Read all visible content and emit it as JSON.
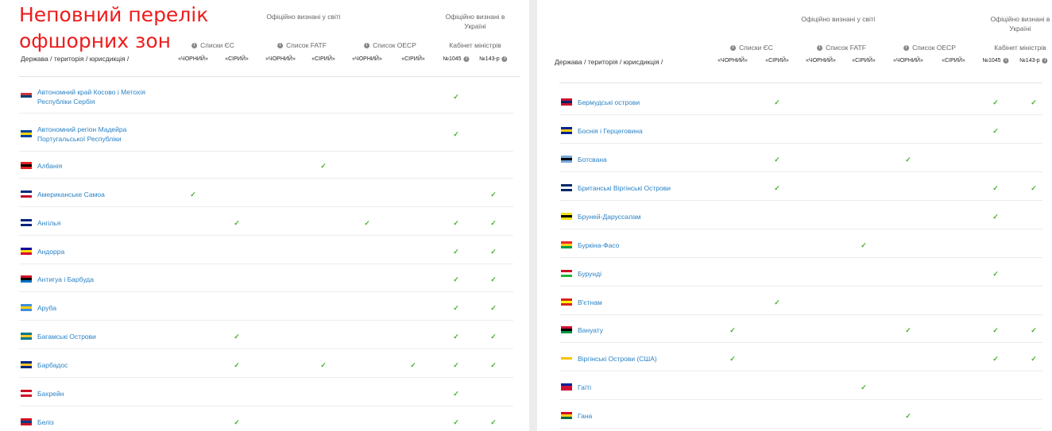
{
  "overlay_title": "Неповний перелік\nофшорних зон",
  "header": {
    "jurisdiction": "Держава / територія / юрисдикція /",
    "world_group": "Офіційно визнані у світі",
    "ukraine_group_line1": "Офіційно визнані в",
    "ukraine_group_line2": "Україні",
    "eu_list": "Списки ЄС",
    "fatf_list": "Список FATF",
    "oecd_list": "Список OECP",
    "cabinet": "Кабінет міністрів",
    "black": "«ЧОРНИЙ»",
    "grey": "«СІРИЙ»",
    "no1045": "№1045",
    "no143": "№143-р",
    "info_glyph": "i"
  },
  "check_glyph": "✓",
  "columns": [
    "eu_black",
    "eu_grey",
    "fatf_black",
    "fatf_grey",
    "oecd_black",
    "oecd_grey",
    "ua_1045",
    "ua_143"
  ],
  "left_rows": [
    {
      "name": "Автономний край Косово і Метохія Республіки Сербія",
      "flag": "kosovo",
      "checks": [
        6
      ]
    },
    {
      "name": "Автономний регіон Мадейра Португальської Республіки",
      "flag": "madeira",
      "checks": [
        6
      ]
    },
    {
      "name": "Албанія",
      "flag": "albania",
      "checks": [
        3
      ]
    },
    {
      "name": "Американське Самоа",
      "flag": "samoa",
      "checks": [
        0,
        7
      ]
    },
    {
      "name": "Ангілья",
      "flag": "anguilla",
      "checks": [
        1,
        4,
        6,
        7
      ]
    },
    {
      "name": "Андорра",
      "flag": "andorra",
      "checks": [
        6,
        7
      ]
    },
    {
      "name": "Антигуа і Барбуда",
      "flag": "antigua",
      "checks": [
        6,
        7
      ]
    },
    {
      "name": "Аруба",
      "flag": "aruba",
      "checks": [
        6,
        7
      ]
    },
    {
      "name": "Багамські Острови",
      "flag": "bahamas",
      "checks": [
        1,
        6,
        7
      ]
    },
    {
      "name": "Барбадос",
      "flag": "barbados",
      "checks": [
        1,
        3,
        5,
        6,
        7
      ]
    },
    {
      "name": "Бахрейн",
      "flag": "bahrain",
      "checks": [
        6
      ]
    },
    {
      "name": "Беліз",
      "flag": "belize",
      "checks": [
        1,
        6,
        7
      ]
    }
  ],
  "right_rows": [
    {
      "name": "Бермудські острови",
      "flag": "bermuda",
      "checks": [
        1,
        6,
        7
      ]
    },
    {
      "name": "Боснія і Герцеговина",
      "flag": "bosnia",
      "checks": [
        6
      ]
    },
    {
      "name": "Ботсвана",
      "flag": "botswana",
      "checks": [
        1,
        4
      ]
    },
    {
      "name": "Британські Віргінські Острови",
      "flag": "bvi",
      "checks": [
        1,
        6,
        7
      ]
    },
    {
      "name": "Бруней-Даруссалам",
      "flag": "brunei",
      "checks": [
        6
      ]
    },
    {
      "name": "Буркіна-Фасо",
      "flag": "burkina",
      "checks": [
        3
      ]
    },
    {
      "name": "Бурунді",
      "flag": "burundi",
      "checks": [
        6
      ]
    },
    {
      "name": "В'єтнам",
      "flag": "vietnam",
      "checks": [
        1
      ]
    },
    {
      "name": "Вануату",
      "flag": "vanuatu",
      "checks": [
        0,
        4,
        6,
        7
      ]
    },
    {
      "name": "Віргінські Острови (США)",
      "flag": "usvi",
      "checks": [
        0,
        6,
        7
      ]
    },
    {
      "name": "Гаїті",
      "flag": "haiti",
      "checks": [
        3
      ]
    },
    {
      "name": "Гана",
      "flag": "ghana",
      "checks": [
        4
      ]
    }
  ]
}
